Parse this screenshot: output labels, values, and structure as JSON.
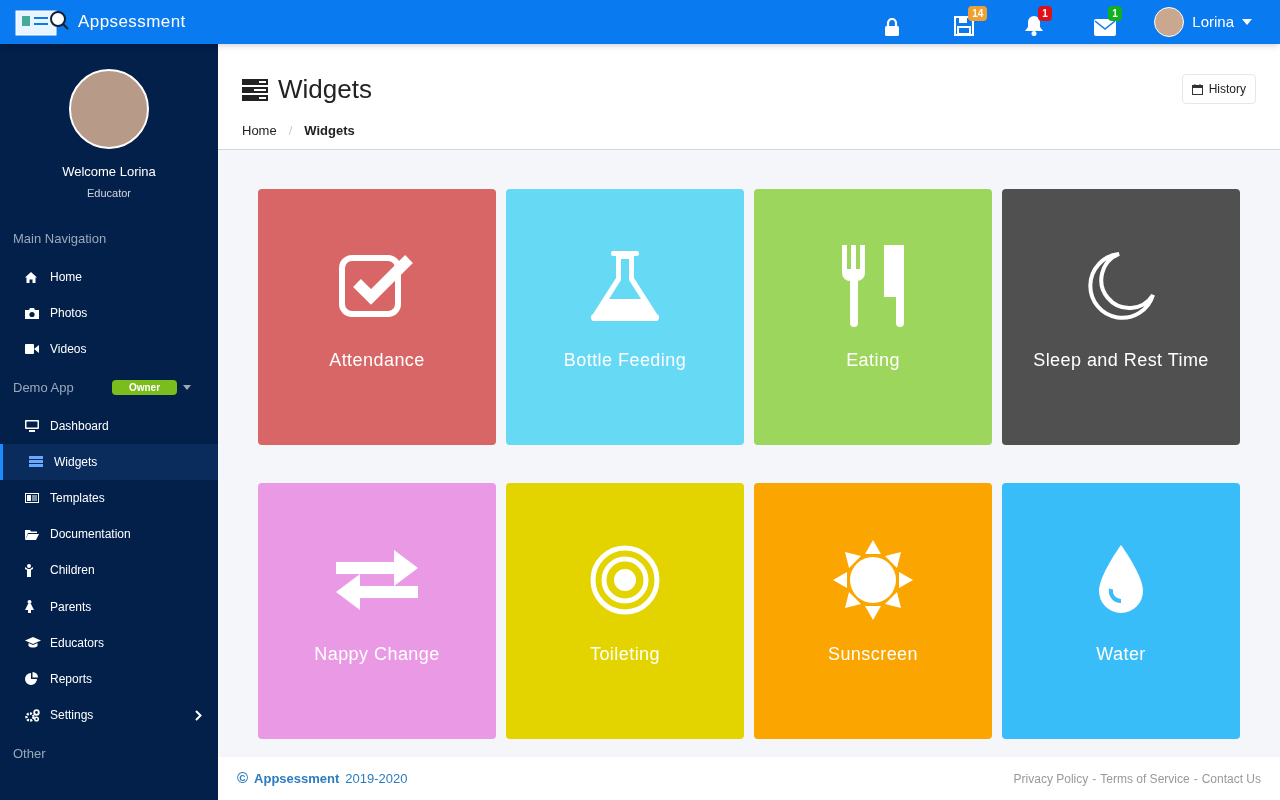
{
  "brand": {
    "name": "Appsessment"
  },
  "topbar": {
    "icons": [
      {
        "badge": "14",
        "color": "#f0a030"
      },
      {
        "badge": "1",
        "color": "#e0101a"
      },
      {
        "badge": "1",
        "color": "#10b020"
      }
    ],
    "user": "Lorina"
  },
  "sidebar": {
    "welcome": "Welcome Lorina",
    "role": "Educator",
    "sections": [
      {
        "title": "Main Navigation",
        "items": [
          {
            "label": "Home",
            "selected": false,
            "submenu": false
          },
          {
            "label": "Photos",
            "selected": false,
            "submenu": false
          },
          {
            "label": "Videos",
            "selected": false,
            "submenu": false
          }
        ]
      },
      {
        "title": "Demo App",
        "tag": "Owner",
        "items": [
          {
            "label": "Dashboard",
            "selected": false,
            "submenu": false
          },
          {
            "label": "Widgets",
            "selected": true,
            "submenu": false
          },
          {
            "label": "Templates",
            "selected": false,
            "submenu": false
          },
          {
            "label": "Documentation",
            "selected": false,
            "submenu": false
          },
          {
            "label": "Children",
            "selected": false,
            "submenu": false
          },
          {
            "label": "Parents",
            "selected": false,
            "submenu": false
          },
          {
            "label": "Educators",
            "selected": false,
            "submenu": false
          },
          {
            "label": "Reports",
            "selected": false,
            "submenu": false
          },
          {
            "label": "Settings",
            "selected": false,
            "submenu": true
          }
        ]
      },
      {
        "title": "Other"
      }
    ]
  },
  "page": {
    "title": "Widgets",
    "breadcrumb": [
      "Home",
      "Widgets"
    ],
    "breadcrumb_separator": "/",
    "history_button": "History"
  },
  "widgets": [
    {
      "label": "Attendance",
      "color": "#d96666"
    },
    {
      "label": "Bottle Feeding",
      "color": "#66d9f5"
    },
    {
      "label": "Eating",
      "color": "#9dd65c"
    },
    {
      "label": "Sleep and Rest Time",
      "color": "#505050"
    },
    {
      "label": "Nappy Change",
      "color": "#ea9ae4"
    },
    {
      "label": "Toileting",
      "color": "#e3d400"
    },
    {
      "label": "Sunscreen",
      "color": "#fba500"
    },
    {
      "label": "Water",
      "color": "#38bdf8"
    }
  ],
  "footer": {
    "symbol": "©",
    "brand": "Appsessment",
    "years": "2019-2020",
    "links": [
      "Privacy Policy",
      "Terms of Service",
      "Contact Us"
    ],
    "link_separator": "-"
  }
}
